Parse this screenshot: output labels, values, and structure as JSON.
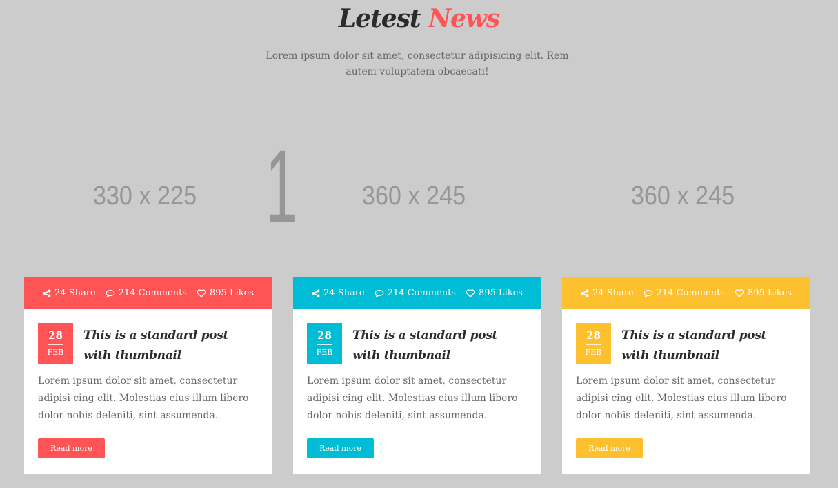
{
  "section": {
    "title_main": "Letest",
    "title_accent": "News",
    "description": "Lorem ipsum dolor sit amet, consectetur adipisicing elit. Rem autem voluptatem obcaecati!"
  },
  "thumbnails": [
    {
      "label": "330 x 225"
    },
    {
      "label": "360 x 245"
    },
    {
      "label": "360 x 245"
    }
  ],
  "overlay_digit": "1",
  "colors": {
    "red": "#ff5455",
    "cyan": "#00bcd4",
    "yellow": "#fdc02f",
    "background": "#cccccc"
  },
  "icons": {
    "share": "share-icon",
    "comments": "comment-icon",
    "likes": "heart-icon"
  },
  "cards": [
    {
      "share": "24 Share",
      "comments": "214 Comments",
      "likes": "895 Likes",
      "day": "28",
      "month": "FEB",
      "title": "This is a standard post with thumbnail",
      "excerpt": "Lorem ipsum dolor sit amet, consectetur adipisi cing elit. Molestias eius illum libero dolor nobis deleniti, sint assumenda.",
      "button": "Read more",
      "color": "#ff5455"
    },
    {
      "share": "24 Share",
      "comments": "214 Comments",
      "likes": "895 Likes",
      "day": "28",
      "month": "FEB",
      "title": "This is a standard post with thumbnail",
      "excerpt": "Lorem ipsum dolor sit amet, consectetur adipisi cing elit. Molestias eius illum libero dolor nobis deleniti, sint assumenda.",
      "button": "Read more",
      "color": "#00bcd4"
    },
    {
      "share": "24 Share",
      "comments": "214 Comments",
      "likes": "895 Likes",
      "day": "28",
      "month": "FEB",
      "title": "This is a standard post with thumbnail",
      "excerpt": "Lorem ipsum dolor sit amet, consectetur adipisi cing elit. Molestias eius illum libero dolor nobis deleniti, sint assumenda.",
      "button": "Read more",
      "color": "#fdc02f"
    }
  ]
}
